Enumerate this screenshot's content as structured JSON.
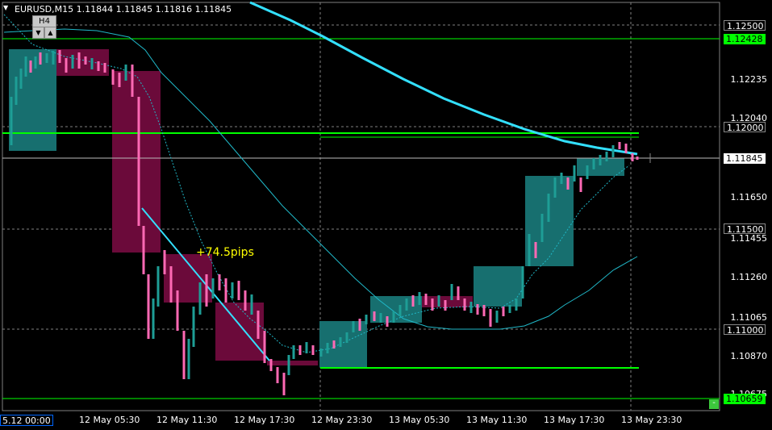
{
  "header": {
    "symbol_line": "EURUSD,M15  1.11844 1.11845 1.11816 1.11845",
    "timeframe_button": "H4",
    "down_arrow": "▼",
    "up_arrow": "▲",
    "menu_triangle": "▼"
  },
  "annotation": {
    "pips_text": "+74.5pips"
  },
  "price_axis": {
    "labels": [
      "1.12235",
      "1.12040",
      "1.11650",
      "1.11455",
      "1.11260",
      "1.11065",
      "1.10870",
      "1.10675"
    ],
    "boxed": {
      "p1": {
        "text": "1.12500",
        "bg": "#000000",
        "fg": "#ffffff"
      },
      "p2": {
        "text": "1.12428",
        "bg": "#00ff00",
        "fg": "#000000"
      },
      "p3": {
        "text": "1.12000",
        "bg": "#000000",
        "fg": "#ffffff"
      },
      "p4": {
        "text": "1.11845",
        "bg": "#ffffff",
        "fg": "#000000"
      },
      "p5": {
        "text": "1.11500",
        "bg": "#000000",
        "fg": "#ffffff"
      },
      "p6": {
        "text": "1.11000",
        "bg": "#000000",
        "fg": "#ffffff"
      },
      "p7": {
        "text": "1.10659",
        "bg": "#00ff00",
        "fg": "#000000"
      }
    }
  },
  "time_axis": {
    "first": "5.12 00:00",
    "labels": [
      "12 May 05:30",
      "12 May 11:30",
      "12 May 17:30",
      "12 May 23:30",
      "13 May 05:30",
      "13 May 11:30",
      "13 May 17:30",
      "13 May 23:30"
    ]
  },
  "minimize_button": "-",
  "colors": {
    "bull_candle": "#1e9e96",
    "bear_candle": "#ff69b4",
    "h4_bull_box": "#176f6f",
    "h4_bear_box": "#6b0a3a",
    "ma_slow": "#33e0ff",
    "level_lines": "#00ff00",
    "grid": "#808080"
  }
}
